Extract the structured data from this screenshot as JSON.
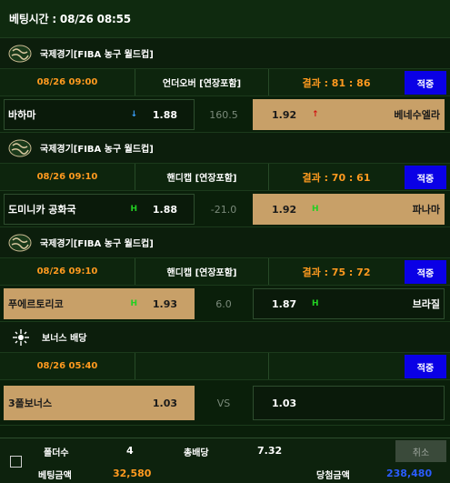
{
  "bet_time": "베팅시간 : 08/26 08:55",
  "games": [
    {
      "league": "국제경기[FIBA 농구 월드컵]",
      "date": "08/26 09:00",
      "type": "언더오버 [연장포함]",
      "result": "결과 : 81 : 86",
      "hit": "적중",
      "home_team": "바하마",
      "home_odd": "1.88",
      "home_ind": "↓",
      "mid": "160.5",
      "away_odd": "1.92",
      "away_ind": "↑",
      "away_team": "베네수엘라",
      "selected": "away"
    },
    {
      "league": "국제경기[FIBA 농구 월드컵]",
      "date": "08/26 09:10",
      "type": "핸디캡 [연장포함]",
      "result": "결과 : 70 : 61",
      "hit": "적중",
      "home_team": "도미니카 공화국",
      "home_odd": "1.88",
      "home_ind": "H",
      "mid": "-21.0",
      "away_odd": "1.92",
      "away_ind": "H",
      "away_team": "파나마",
      "selected": "away"
    },
    {
      "league": "국제경기[FIBA 농구 월드컵]",
      "date": "08/26 09:10",
      "type": "핸디캡 [연장포함]",
      "result": "결과 : 75 : 72",
      "hit": "적중",
      "home_team": "푸에르토리코",
      "home_odd": "1.93",
      "home_ind": "H",
      "mid": "6.0",
      "away_odd": "1.87",
      "away_ind": "H",
      "away_team": "브라질",
      "selected": "home"
    }
  ],
  "bonus": {
    "title": "보너스 배당",
    "date": "08/26 05:40",
    "hit": "적중",
    "home_team": "3폴보너스",
    "home_odd": "1.03",
    "mid": "VS",
    "away_odd": "1.03"
  },
  "footer": {
    "folder_label": "폴더수",
    "folder_value": "4",
    "total_odds_label": "총배당",
    "total_odds_value": "7.32",
    "cancel_label": "취소",
    "bet_amount_label": "베팅금액",
    "bet_amount_value": "32,580",
    "win_amount_label": "당첨금액",
    "win_amount_value": "238,480"
  },
  "colors": {
    "background": "#0a1f0a",
    "date": "#ff9a1f",
    "selected": "#c8a068",
    "hit_badge": "#0a00e6",
    "handicap_marker": "#22d022",
    "win_amount": "#2a5cff"
  }
}
